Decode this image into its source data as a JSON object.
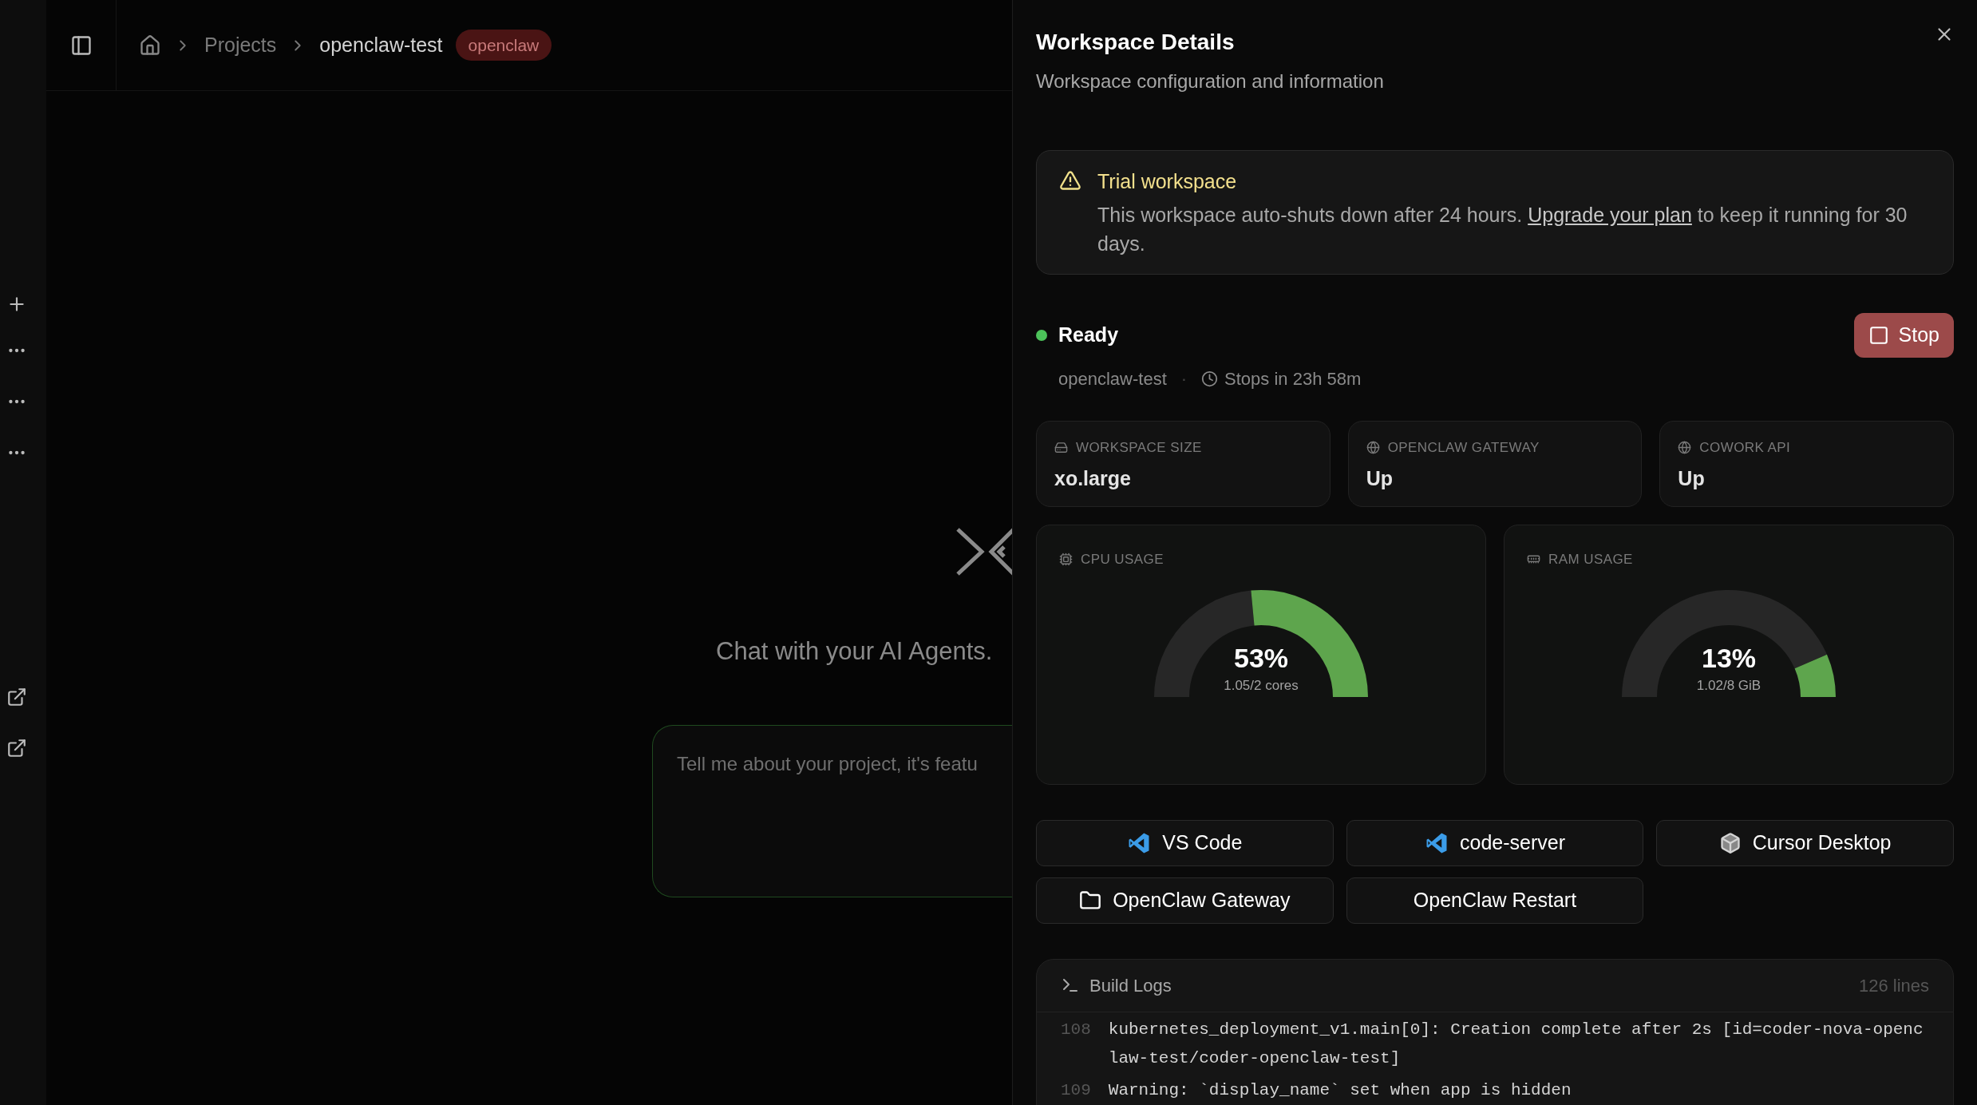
{
  "breadcrumb": {
    "items": [
      {
        "label": "Projects",
        "current": false
      },
      {
        "label": "openclaw-test",
        "current": true
      }
    ],
    "badge": "openclaw"
  },
  "chat": {
    "heading": "Chat with your AI Agents.",
    "placeholder": "Tell me about your project, it's featu"
  },
  "panel": {
    "title": "Workspace Details",
    "subtitle": "Workspace configuration and information",
    "alert": {
      "title": "Trial workspace",
      "before": "This workspace auto-shuts down after 24 hours.",
      "link": "Upgrade your plan",
      "after": "to keep it running for 30 days."
    },
    "status": {
      "kind": "ready",
      "label": "Ready",
      "workspace": "openclaw-test",
      "separator": "·",
      "stops": "Stops in 23h 58m"
    },
    "stop_button": "Stop",
    "info_cards": [
      {
        "kind": "drive",
        "label": "WORKSPACE SIZE",
        "value": "xo.large"
      },
      {
        "kind": "globe",
        "label": "OPENCLAW GATEWAY",
        "value": "Up"
      },
      {
        "kind": "globe",
        "label": "COWORK API",
        "value": "Up"
      }
    ],
    "usage": [
      {
        "kind": "cpu",
        "label": "CPU USAGE",
        "percent": "53%",
        "detail": "1.05/2 cores",
        "level": 0.53
      },
      {
        "kind": "memory",
        "label": "RAM USAGE",
        "percent": "13%",
        "detail": "1.02/8 GiB",
        "level": 0.13
      }
    ],
    "apps": [
      {
        "kind": "vscode",
        "label": "VS Code"
      },
      {
        "kind": "vscode",
        "label": "code-server"
      },
      {
        "kind": "cube",
        "label": "Cursor Desktop"
      },
      {
        "kind": "folder",
        "label": "OpenClaw Gateway"
      },
      {
        "kind": "plain",
        "label": "OpenClaw Restart"
      }
    ],
    "logs": {
      "title": "Build Logs",
      "count": "126 lines",
      "lines": [
        {
          "number": "108",
          "text": "kubernetes_deployment_v1.main[0]: Creation complete after 2s [id=coder-nova-openclaw-test/coder-openclaw-test]"
        },
        {
          "number": "109",
          "text": "Warning: `display_name` set when app is hidden"
        }
      ]
    }
  }
}
